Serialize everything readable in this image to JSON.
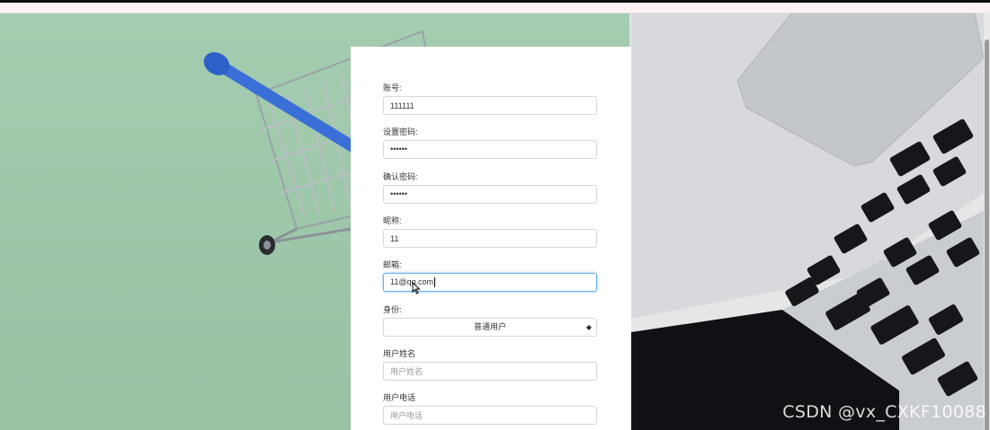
{
  "form": {
    "account": {
      "label": "账号:",
      "value": "111111"
    },
    "password": {
      "label": "设置密码:",
      "value": "••••••"
    },
    "confirm_password": {
      "label": "确认密码:",
      "value": "••••••"
    },
    "nickname": {
      "label": "昵称:",
      "value": "11"
    },
    "email": {
      "label": "邮箱:",
      "value": "11@qq.com"
    },
    "identity": {
      "label": "身份:",
      "selected": "普通用户"
    },
    "real_name": {
      "label": "用户姓名",
      "placeholder": "用户姓名"
    },
    "phone": {
      "label": "用户电话",
      "placeholder": "用户电话"
    }
  },
  "watermark": "CSDN @vx_CXKF10088",
  "colors": {
    "background": "#9cc7a8",
    "focus": "#66afe9",
    "cart_handle": "#3a6fd8"
  }
}
